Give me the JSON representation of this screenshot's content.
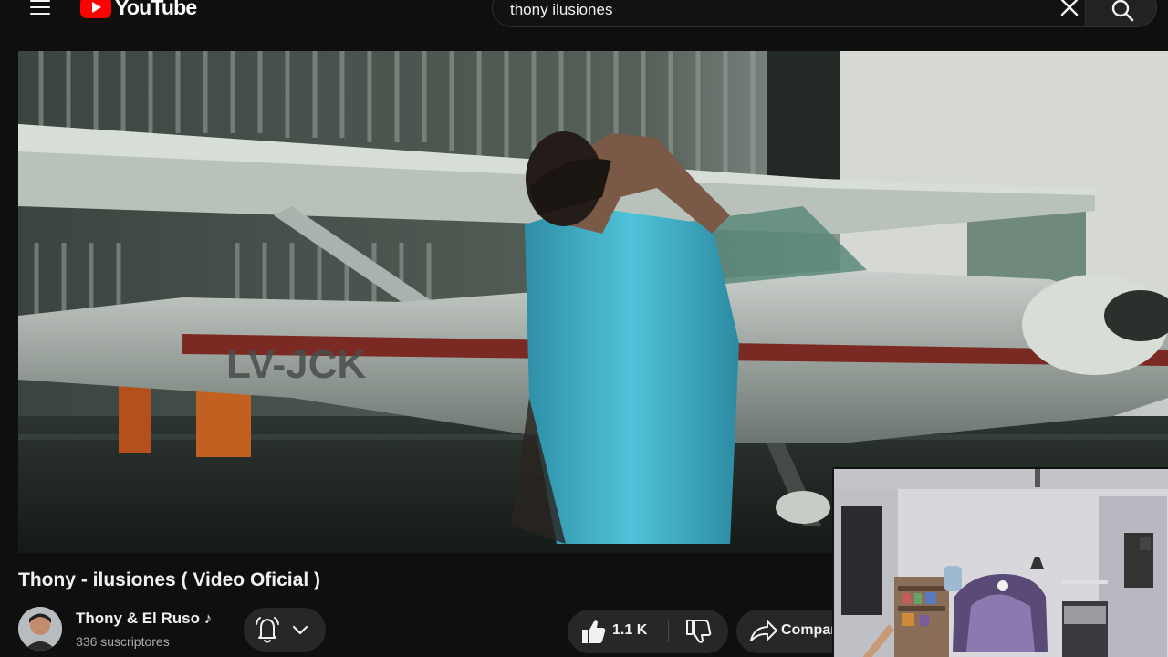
{
  "header": {
    "logo_text": "YouTube",
    "search": {
      "value": "thony ilusiones"
    }
  },
  "player": {
    "plate_text": "LV-JCK"
  },
  "video": {
    "title": "Thony - ilusiones ( Video Oficial )",
    "channel_name": "Thony & El Ruso ♪",
    "subscribers": "336 suscriptores",
    "likes": "1.1 K",
    "share_label": "Compartir"
  },
  "colors": {
    "background": "#0f0f0f",
    "brand_red": "#ff0000",
    "button_bg": "#272727",
    "text_primary": "#f1f1f1",
    "text_secondary": "#aaaaaa"
  },
  "icons": {
    "menu": "hamburger-icon",
    "logo": "play-logo-icon",
    "clear": "close-icon",
    "search": "search-icon",
    "bell": "bell-icon",
    "chevron": "chevron-down-icon",
    "like": "thumbs-up-icon",
    "dislike": "thumbs-down-icon",
    "share": "share-arrow-icon"
  }
}
